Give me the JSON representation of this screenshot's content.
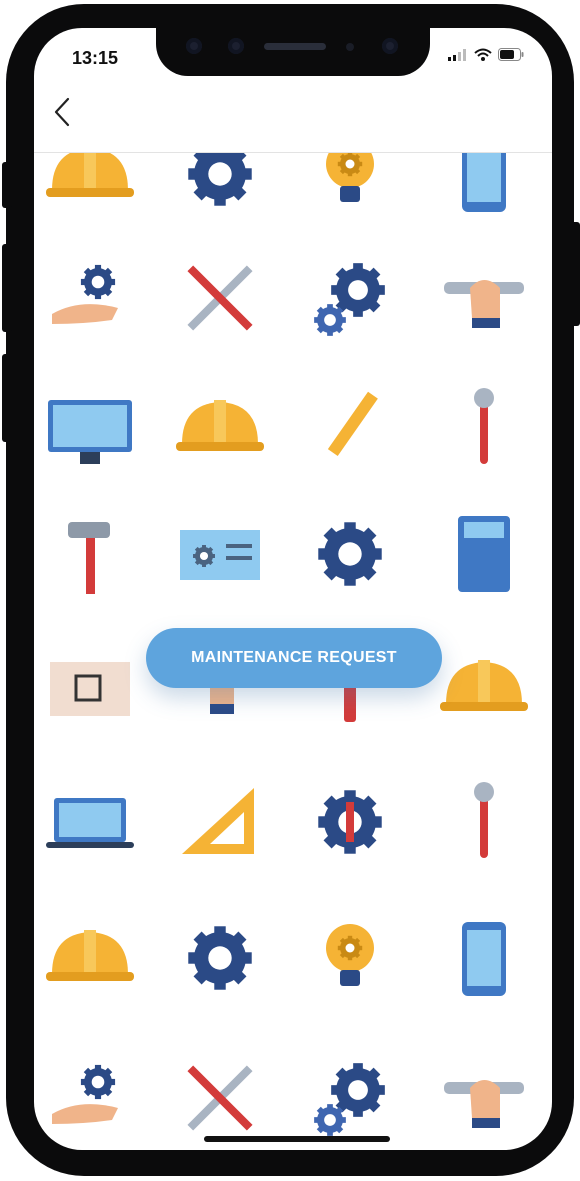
{
  "status_bar": {
    "time": "13:15"
  },
  "nav": {
    "back_icon": "chevron-left-icon"
  },
  "button": {
    "label": "MAINTENANCE REQUEST"
  },
  "colors": {
    "button_bg": "#5ea4dd",
    "navy": "#2b4a86",
    "yellow": "#f5b335",
    "red": "#d33b3a",
    "sky": "#8fcaf0"
  },
  "pattern_icons": [
    "helmet-icon",
    "gear-icon",
    "lightbulb-icon",
    "phone-icon",
    "hand-gear-icon",
    "tools-icon",
    "gears-icon",
    "hand-wrench-icon",
    "monitor-icon",
    "helmet-icon",
    "pencil-icon",
    "wrench-icon",
    "hammer-icon",
    "blueprint-icon",
    "gear-icon",
    "calculator-icon",
    "plan-icon",
    "hand-measure-icon",
    "screwdriver-icon",
    "helmet-icon",
    "laptop-icon",
    "set-square-icon",
    "gear-wrench-icon",
    "wrench-icon",
    "helmet-icon",
    "gear-icon",
    "lightbulb-icon",
    "phone-icon",
    "hand-gear-icon",
    "tools-icon",
    "gears-icon",
    "hand-wrench-icon"
  ]
}
